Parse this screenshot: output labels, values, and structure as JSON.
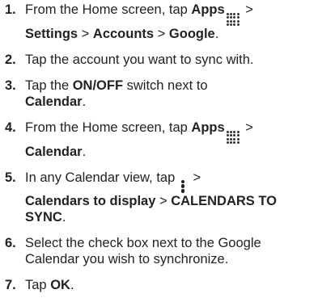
{
  "steps": [
    {
      "num": "1.",
      "parts": [
        "From the Home screen, tap ",
        "Apps",
        " > ",
        "Settings",
        " > ",
        "Accounts",
        " > ",
        "Google",
        "."
      ]
    },
    {
      "num": "2.",
      "parts": [
        "Tap the account you want to sync with."
      ]
    },
    {
      "num": "3.",
      "parts": [
        "Tap the ",
        "ON/OFF",
        " switch next to ",
        "Calendar",
        "."
      ]
    },
    {
      "num": "4.",
      "parts": [
        "From the Home screen, tap ",
        "Apps",
        " > ",
        "Calendar",
        "."
      ]
    },
    {
      "num": "5.",
      "parts": [
        "In any Calendar view, tap ",
        " > ",
        "Calendars to display",
        " > ",
        "CALENDARS TO SYNC",
        "."
      ]
    },
    {
      "num": "6.",
      "parts": [
        "Select the check box next to the Google Calendar you wish to synchronize."
      ]
    },
    {
      "num": "7.",
      "parts": [
        "Tap ",
        "OK",
        "."
      ]
    }
  ],
  "icons": {
    "apps": "apps-grid-icon",
    "menu": "vertical-dots-menu-icon"
  }
}
